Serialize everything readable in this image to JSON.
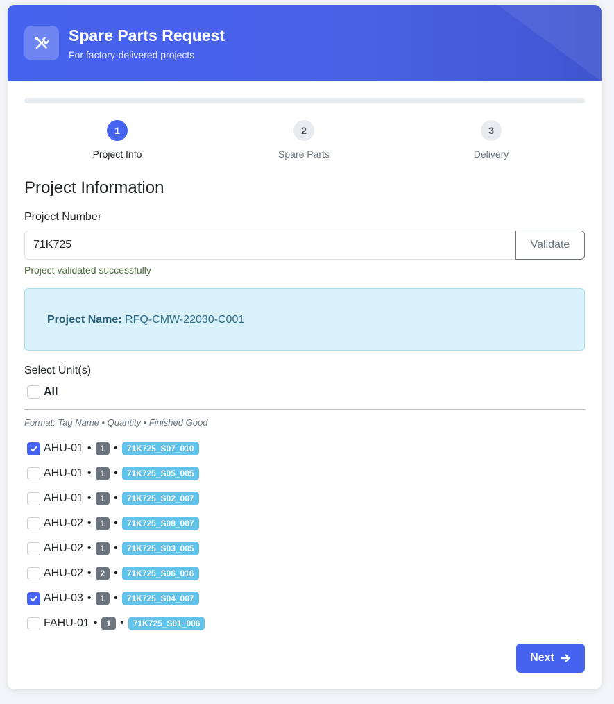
{
  "header": {
    "title": "Spare Parts Request",
    "subtitle": "For factory-delivered projects",
    "icon": "tools-icon"
  },
  "steps": [
    {
      "number": "1",
      "label": "Project Info",
      "active": true
    },
    {
      "number": "2",
      "label": "Spare Parts",
      "active": false
    },
    {
      "number": "3",
      "label": "Delivery",
      "active": false
    }
  ],
  "section_title": "Project Information",
  "project_number": {
    "label": "Project Number",
    "value": "71K725",
    "validate_label": "Validate",
    "status_message": "Project validated successfully"
  },
  "project_info": {
    "name_label": "Project Name:",
    "name_value": "RFQ-CMW-22030-C001"
  },
  "units": {
    "label": "Select Unit(s)",
    "all_label": "All",
    "format_hint": "Format: Tag Name • Quantity • Finished Good",
    "separator": "•",
    "items": [
      {
        "tag": "AHU-01",
        "qty": "1",
        "fg": "71K725_S07_010",
        "checked": true
      },
      {
        "tag": "AHU-01",
        "qty": "1",
        "fg": "71K725_S05_005",
        "checked": false
      },
      {
        "tag": "AHU-01",
        "qty": "1",
        "fg": "71K725_S02_007",
        "checked": false
      },
      {
        "tag": "AHU-02",
        "qty": "1",
        "fg": "71K725_S08_007",
        "checked": false
      },
      {
        "tag": "AHU-02",
        "qty": "1",
        "fg": "71K725_S03_005",
        "checked": false
      },
      {
        "tag": "AHU-02",
        "qty": "2",
        "fg": "71K725_S06_016",
        "checked": false
      },
      {
        "tag": "AHU-03",
        "qty": "1",
        "fg": "71K725_S04_007",
        "checked": true
      },
      {
        "tag": "FAHU-01",
        "qty": "1",
        "fg": "71K725_S01_006",
        "checked": false
      }
    ]
  },
  "next_button": {
    "label": "Next",
    "icon": "arrow-right-icon"
  },
  "colors": {
    "primary": "#4563ef",
    "info_bg": "#d8f1fb",
    "success_text": "#4d6b3c",
    "badge_gray": "#6c757d",
    "badge_info": "#62c3ea"
  }
}
